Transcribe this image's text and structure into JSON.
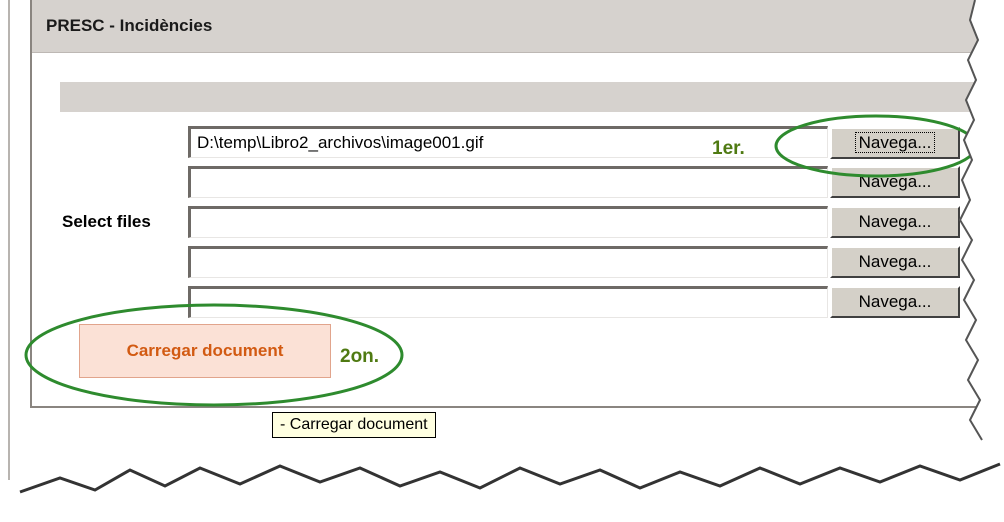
{
  "header": {
    "title": "PRESC - Incidències"
  },
  "form": {
    "select_label": "Select files",
    "files": [
      {
        "value": "D:\\temp\\Libro2_archivos\\image001.gif",
        "browse": "Navega..."
      },
      {
        "value": "",
        "browse": "Navega..."
      },
      {
        "value": "",
        "browse": "Navega..."
      },
      {
        "value": "",
        "browse": "Navega..."
      },
      {
        "value": "",
        "browse": "Navega..."
      }
    ],
    "upload_button": "Carregar document"
  },
  "annotations": {
    "step1": "1er.",
    "step2": "2on.",
    "highlight_color": "#2e8b2e",
    "step_color": "#4f7a12"
  },
  "tooltip": "- Carregar document",
  "colors": {
    "header_bg": "#d6d2ce",
    "button_bg": "#d4d0c8",
    "upload_bg": "#fbe1d6",
    "upload_text": "#d25a12",
    "tooltip_bg": "#ffffe1"
  }
}
